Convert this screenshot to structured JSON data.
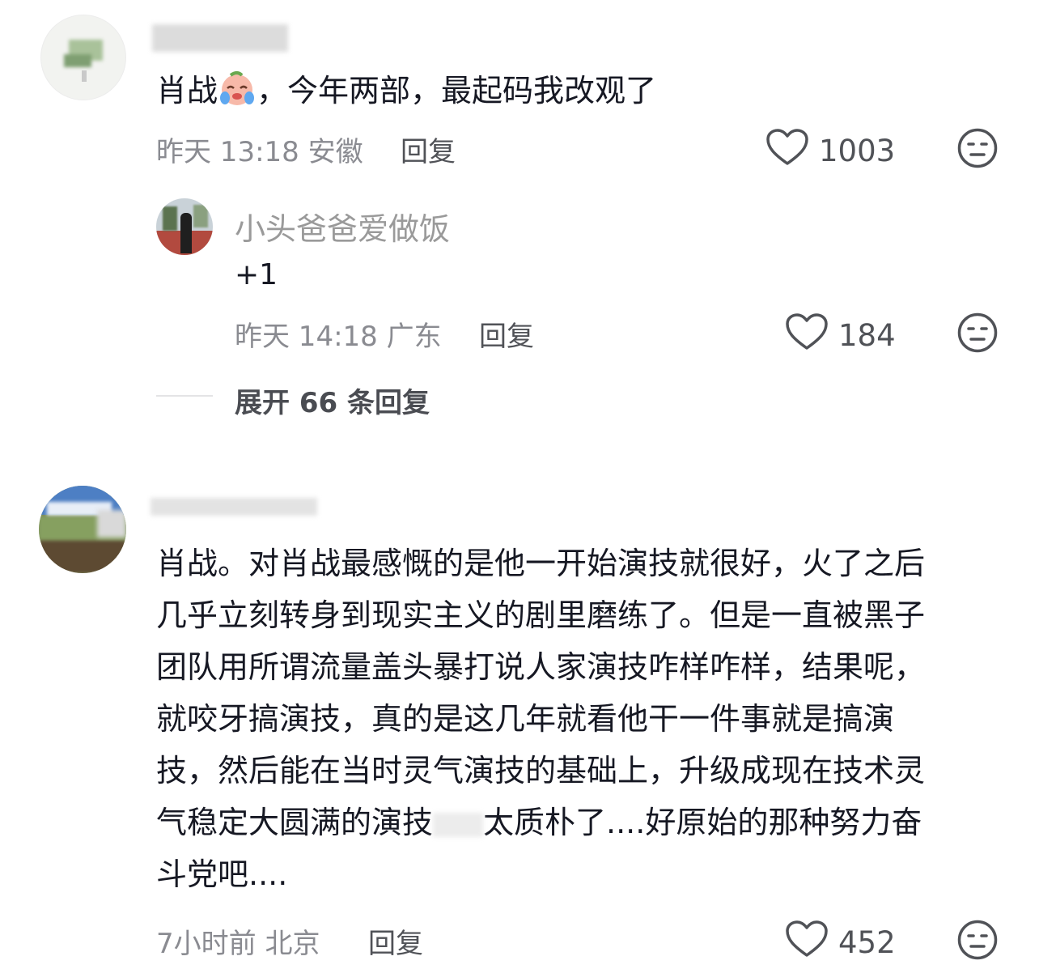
{
  "comments": [
    {
      "text_before_emoji": "肖战",
      "emoji": "crying-face-emoji",
      "text_after_emoji": "，今年两部，最起码我改观了",
      "time": "昨天 13:18",
      "location": "安徽",
      "reply_label": "回复",
      "likes": "1003",
      "reply": {
        "username": "小头爸爸爱做饭",
        "text": "+1",
        "time": "昨天 14:18",
        "location": "广东",
        "reply_label": "回复",
        "likes": "184"
      },
      "expand_label": "展开 66 条回复"
    },
    {
      "lines": [
        "肖战。对肖战最感慨的是他一开始演技就很好，火了之后",
        "几乎立刻转身到现实主义的剧里磨练了。但是一直被黑子",
        "团队用所谓流量盖头暴打说人家演技咋样咋样，结果呢，",
        "就咬牙搞演技，真的是这几年就看他干一件事就是搞演",
        "技，然后能在当时灵气演技的基础上，升级成现在技术灵",
        "气稳定大圆满的演技",
        "太质朴了....好原始的那种努力奋",
        "斗党吧...."
      ],
      "time": "7小时前",
      "location": "北京",
      "reply_label": "回复",
      "likes": "452"
    }
  ],
  "colors": {
    "text": "#161823",
    "meta": "#8a8b91",
    "name": "#9a9a9a"
  }
}
